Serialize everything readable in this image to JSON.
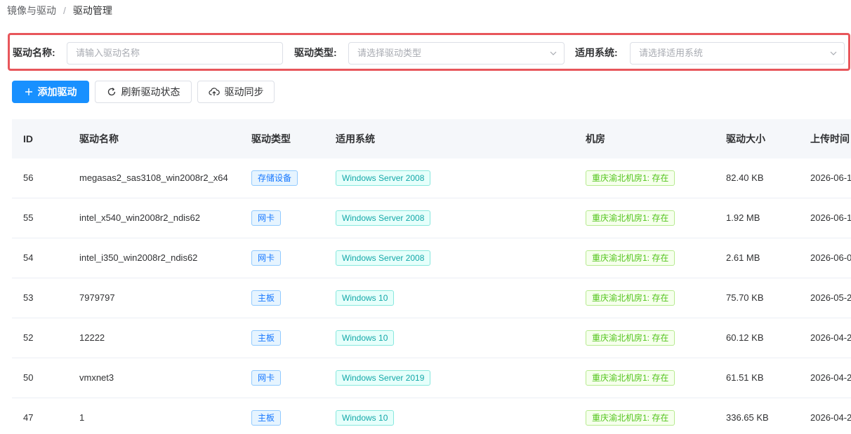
{
  "breadcrumb": {
    "parent": "镜像与驱动",
    "separator": "/",
    "current": "驱动管理"
  },
  "filters": {
    "name": {
      "label": "驱动名称:",
      "placeholder": "请输入驱动名称"
    },
    "type": {
      "label": "驱动类型:",
      "placeholder": "请选择驱动类型"
    },
    "system": {
      "label": "适用系统:",
      "placeholder": "请选择适用系统"
    }
  },
  "toolbar": {
    "add_label": "添加驱动",
    "refresh_label": "刷新驱动状态",
    "sync_label": "驱动同步"
  },
  "table": {
    "columns": {
      "id": "ID",
      "name": "驱动名称",
      "type": "驱动类型",
      "system": "适用系统",
      "room": "机房",
      "size": "驱动大小",
      "time": "上传时间"
    },
    "rows": [
      {
        "id": "56",
        "name": "megasas2_sas3108_win2008r2_x64",
        "type": "存储设备",
        "system": "Windows Server 2008",
        "room": "重庆渝北机房1: 存在",
        "size": "82.40 KB",
        "time": "2026-06-1"
      },
      {
        "id": "55",
        "name": "intel_x540_win2008r2_ndis62",
        "type": "网卡",
        "system": "Windows Server 2008",
        "room": "重庆渝北机房1: 存在",
        "size": "1.92 MB",
        "time": "2026-06-1"
      },
      {
        "id": "54",
        "name": "intel_i350_win2008r2_ndis62",
        "type": "网卡",
        "system": "Windows Server 2008",
        "room": "重庆渝北机房1: 存在",
        "size": "2.61 MB",
        "time": "2026-06-0"
      },
      {
        "id": "53",
        "name": "7979797",
        "type": "主板",
        "system": "Windows 10",
        "room": "重庆渝北机房1: 存在",
        "size": "75.70 KB",
        "time": "2026-05-2"
      },
      {
        "id": "52",
        "name": "12222",
        "type": "主板",
        "system": "Windows 10",
        "room": "重庆渝北机房1: 存在",
        "size": "60.12 KB",
        "time": "2026-04-2"
      },
      {
        "id": "50",
        "name": "vmxnet3",
        "type": "网卡",
        "system": "Windows Server 2019",
        "room": "重庆渝北机房1: 存在",
        "size": "61.51 KB",
        "time": "2026-04-2"
      },
      {
        "id": "47",
        "name": "1",
        "type": "主板",
        "system": "Windows 10",
        "room": "重庆渝北机房1: 存在",
        "size": "336.65 KB",
        "time": "2026-04-2"
      }
    ]
  },
  "colors": {
    "primary": "#1890ff",
    "highlight_border": "#e8565b",
    "tag_blue": "#1677ff",
    "tag_cyan": "#13a8a8",
    "tag_green": "#52c41a"
  },
  "icons": {
    "add": "plus-icon",
    "refresh": "refresh-icon",
    "sync": "cloud-upload-icon",
    "select": "chevron-down-icon"
  }
}
